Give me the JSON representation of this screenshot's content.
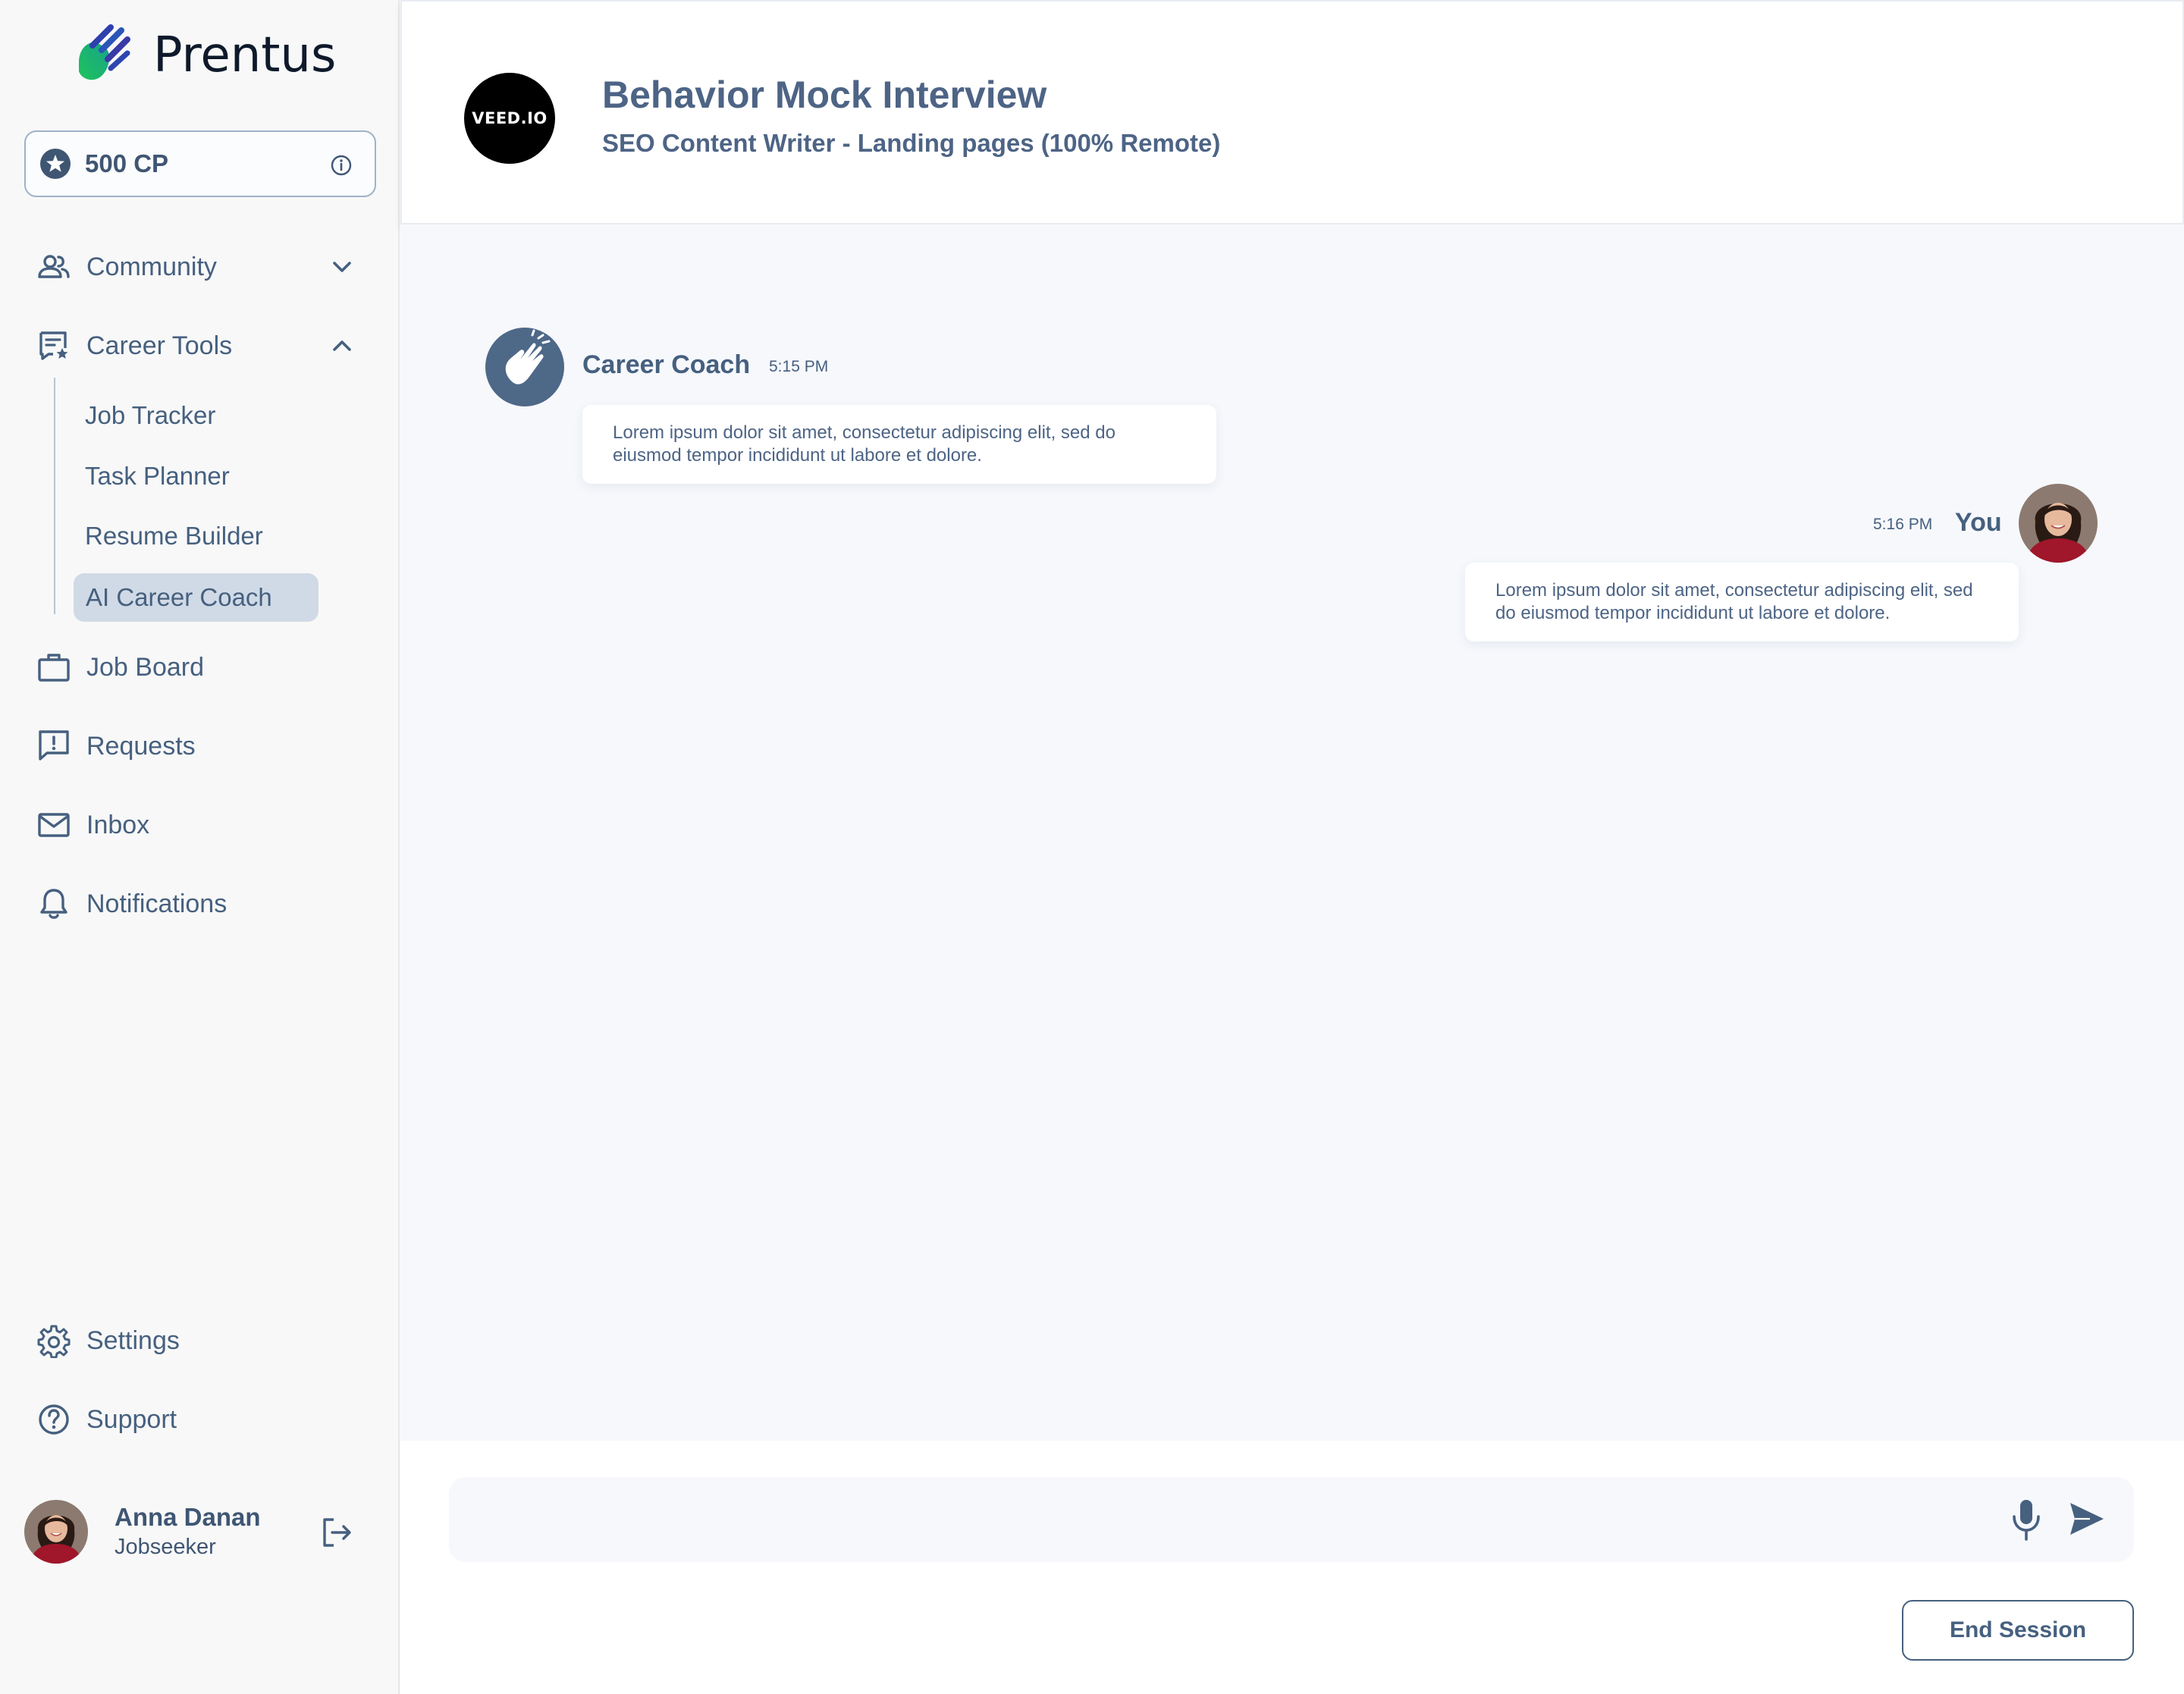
{
  "brand": {
    "name": "Prentus"
  },
  "points": {
    "label": "500 CP"
  },
  "nav": {
    "community": "Community",
    "career_tools": "Career Tools",
    "sub": {
      "job_tracker": "Job Tracker",
      "task_planner": "Task Planner",
      "resume_builder": "Resume Builder",
      "ai_career_coach": "AI Career Coach"
    },
    "job_board": "Job Board",
    "requests": "Requests",
    "inbox": "Inbox",
    "notifications": "Notifications",
    "settings": "Settings",
    "support": "Support"
  },
  "user": {
    "name": "Anna Danan",
    "role": "Jobseeker"
  },
  "header": {
    "company_logo_text": "VEED.IO",
    "title": "Behavior Mock Interview",
    "subtitle": "SEO Content Writer - Landing pages (100% Remote)"
  },
  "chat": {
    "messages": [
      {
        "sender": "Career Coach",
        "time": "5:15 PM",
        "text": "Lorem ipsum dolor sit amet, consectetur adipiscing elit, sed do eiusmod tempor incididunt ut labore et dolore."
      },
      {
        "sender": "You",
        "time": "5:16 PM",
        "text": "Lorem ipsum dolor sit amet, consectetur adipiscing elit, sed do eiusmod tempor incididunt ut labore et dolore."
      }
    ]
  },
  "composer": {
    "value": "",
    "placeholder": ""
  },
  "actions": {
    "end_session": "End Session"
  },
  "colors": {
    "primary": "#46607f",
    "active_nav_bg": "#d0dae6",
    "brand_green": "#22c55e",
    "brand_indigo": "#3b3fb6"
  }
}
